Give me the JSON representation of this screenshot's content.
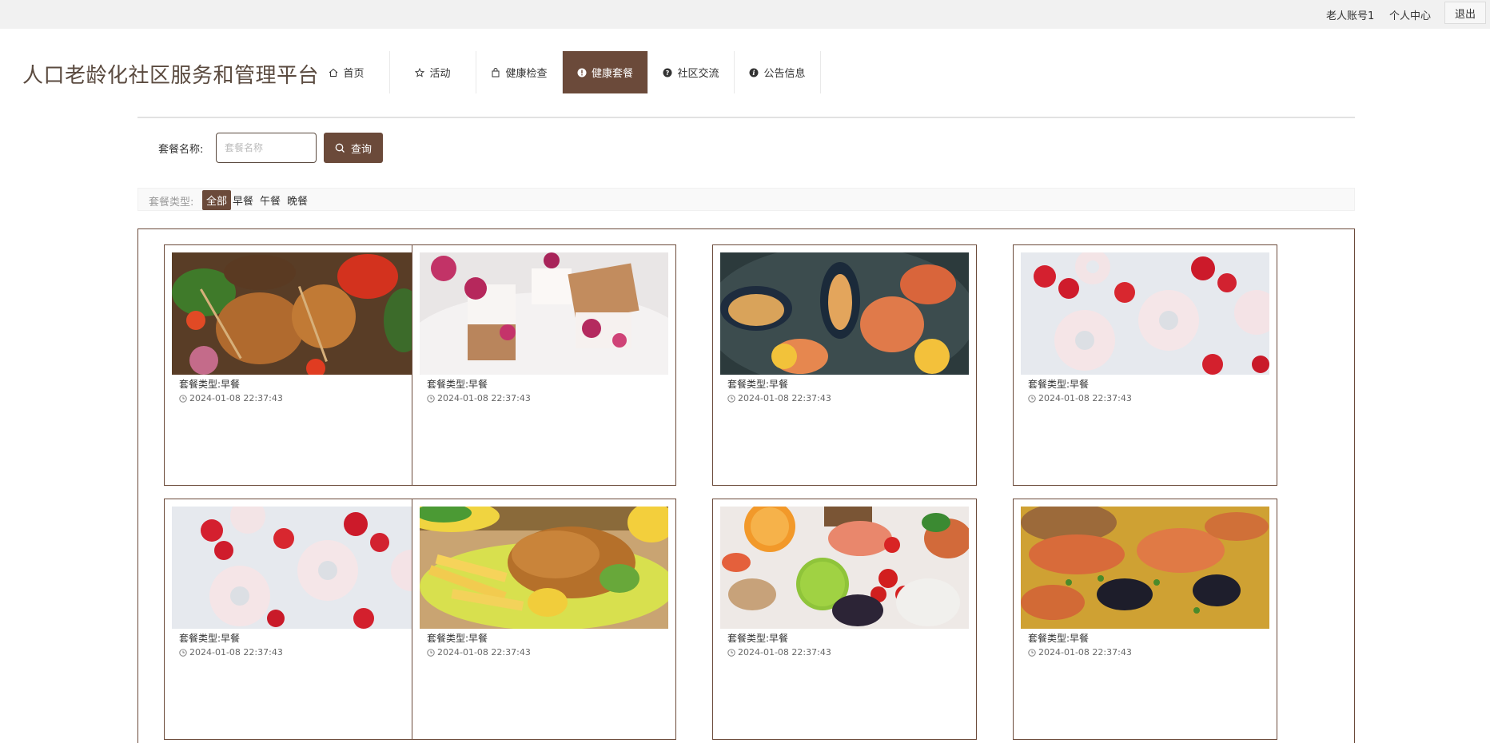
{
  "topbar": {
    "account": "老人账号1",
    "personal_center": "个人中心",
    "logout": "退出"
  },
  "site_title": "人口老龄化社区服务和管理平台",
  "nav": [
    {
      "label": "首页",
      "icon": "home-icon",
      "active": false
    },
    {
      "label": "活动",
      "icon": "star-icon",
      "active": false
    },
    {
      "label": "健康检查",
      "icon": "bag-icon",
      "active": false
    },
    {
      "label": "健康套餐",
      "icon": "info-circle-icon",
      "active": true
    },
    {
      "label": "社区交流",
      "icon": "question-circle-icon",
      "active": false
    },
    {
      "label": "公告信息",
      "icon": "info-circle-icon",
      "active": false
    }
  ],
  "search": {
    "label": "套餐名称:",
    "placeholder": "套餐名称",
    "value": "",
    "button": "查询"
  },
  "filter": {
    "label": "套餐类型:",
    "options": [
      "全部",
      "早餐",
      "午餐",
      "晚餐"
    ],
    "selected": "全部"
  },
  "cards": [
    {
      "type_label": "套餐类型:早餐",
      "date": "2024-01-08 22:37:43",
      "image": "grilled-chicken-skewers"
    },
    {
      "type_label": "套餐类型:早餐",
      "date": "2024-01-08 22:37:43",
      "image": "waffle-berry-dessert"
    },
    {
      "type_label": "套餐类型:早餐",
      "date": "2024-01-08 22:37:43",
      "image": "seafood-mussels-shrimp"
    },
    {
      "type_label": "套餐类型:早餐",
      "date": "2024-01-08 22:37:43",
      "image": "strawberry-donuts"
    },
    {
      "type_label": "套餐类型:早餐",
      "date": "2024-01-08 22:37:43",
      "image": "strawberry-donuts"
    },
    {
      "type_label": "套餐类型:早餐",
      "date": "2024-01-08 22:37:43",
      "image": "fried-chicken-fries"
    },
    {
      "type_label": "套餐类型:早餐",
      "date": "2024-01-08 22:37:43",
      "image": "fruit-vegetables"
    },
    {
      "type_label": "套餐类型:早餐",
      "date": "2024-01-08 22:37:43",
      "image": "seafood-paella"
    }
  ],
  "colors": {
    "primary": "#6b4a3a",
    "title": "#5a4a3f",
    "topbar_bg": "#f1f1f1"
  }
}
